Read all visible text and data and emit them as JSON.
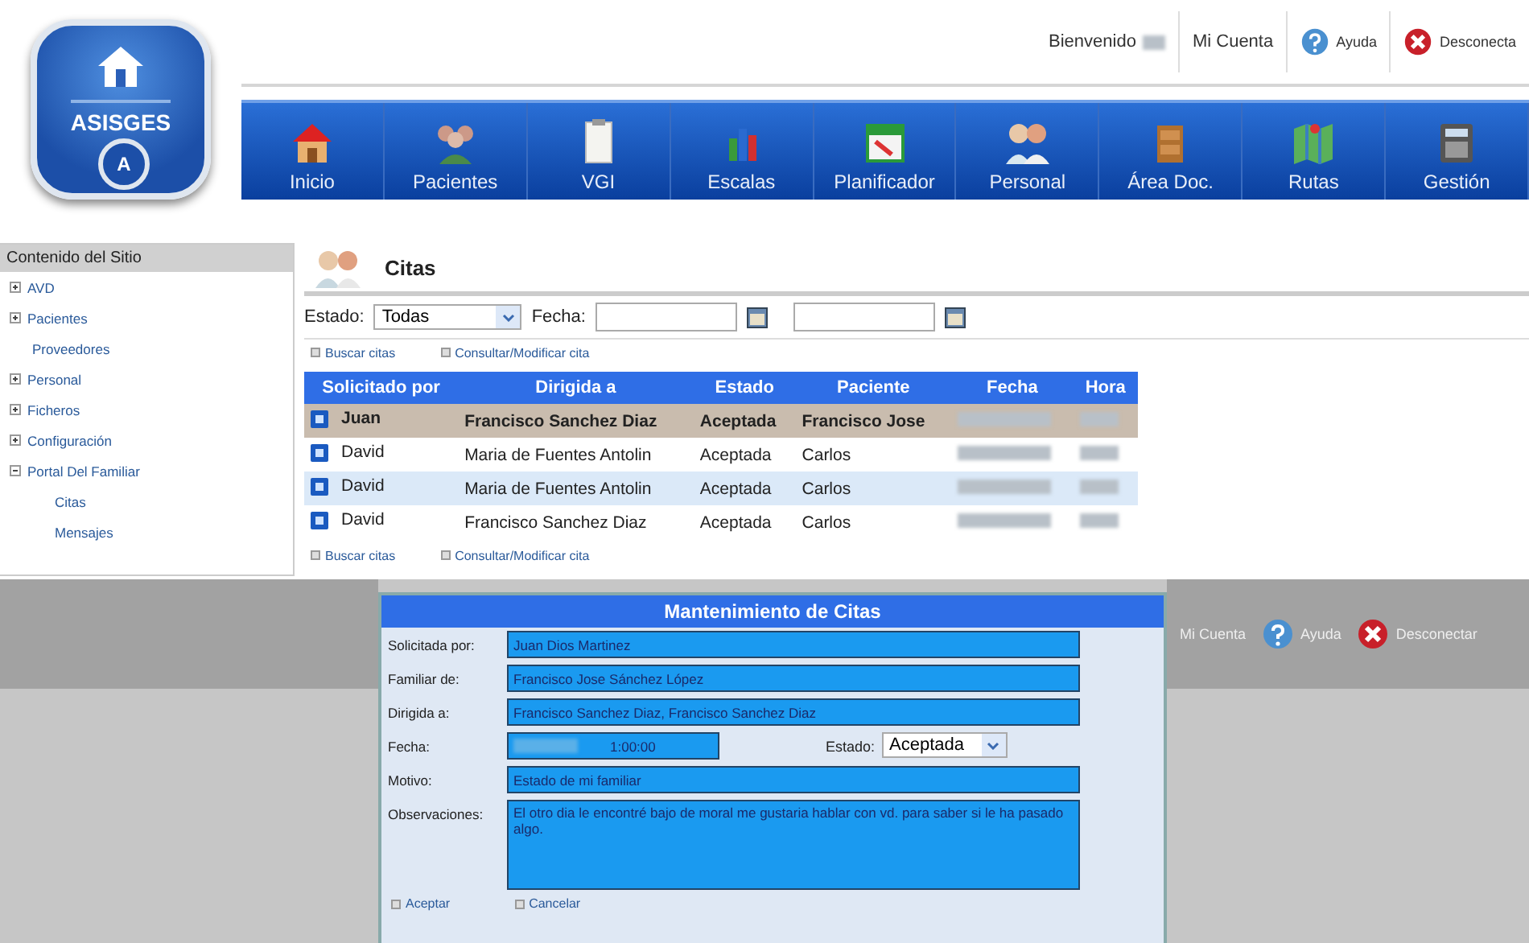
{
  "logo": {
    "name": "ASISGES",
    "badge": "A"
  },
  "user_bar": {
    "greeting": "Bienvenido",
    "links": [
      {
        "label": "Mi Cuenta",
        "kind": "plain"
      },
      {
        "label": "Ayuda",
        "kind": "help"
      },
      {
        "label": "Desconecta",
        "kind": "logout"
      }
    ]
  },
  "nav": [
    {
      "label": "Inicio",
      "kind": "home"
    },
    {
      "label": "Pacientes",
      "kind": "people"
    },
    {
      "label": "VGI",
      "kind": "clipboard"
    },
    {
      "label": "Escalas",
      "kind": "chart"
    },
    {
      "label": "Planificador",
      "kind": "calendar"
    },
    {
      "label": "Personal",
      "kind": "staff"
    },
    {
      "label": "Área Doc.",
      "kind": "cabinet"
    },
    {
      "label": "Rutas",
      "kind": "map"
    },
    {
      "label": "Gestión",
      "kind": "calculator"
    }
  ],
  "sidebar": {
    "title": "Contenido del Sitio",
    "items": [
      {
        "label": "AVD",
        "expanded": false
      },
      {
        "label": "Pacientes",
        "expanded": false
      },
      {
        "label": "Proveedores"
      },
      {
        "label": "Personal",
        "expanded": false
      },
      {
        "label": "Ficheros",
        "expanded": false
      },
      {
        "label": "Configuración",
        "expanded": false
      },
      {
        "label": "Portal Del Familiar",
        "expanded": true,
        "children": [
          {
            "label": "Citas"
          },
          {
            "label": "Mensajes"
          }
        ]
      }
    ]
  },
  "citas": {
    "title": "Citas",
    "estado_label": "Estado:",
    "estado_value": "Todas",
    "fecha_label": "Fecha:",
    "actions_top": [
      "Buscar citas",
      "Consultar/Modificar cita"
    ],
    "columns": [
      "Solicitado por",
      "Dirigida a",
      "Estado",
      "Paciente",
      "Fecha",
      "Hora"
    ],
    "rows": [
      {
        "solicitado_por": "Juan",
        "dirigida_a": "Francisco Sanchez Diaz",
        "estado": "Aceptada",
        "paciente": "Francisco Jose",
        "selected": true,
        "highlighted": false
      },
      {
        "solicitado_por": "David",
        "dirigida_a": "Maria de Fuentes Antolin",
        "estado": "Aceptada",
        "paciente": "Carlos",
        "selected": false,
        "highlighted": false
      },
      {
        "solicitado_por": "David",
        "dirigida_a": "Maria de Fuentes Antolin",
        "estado": "Aceptada",
        "paciente": "Carlos",
        "selected": false,
        "highlighted": true
      },
      {
        "solicitado_por": "David",
        "dirigida_a": "Francisco Sanchez Diaz",
        "estado": "Aceptada",
        "paciente": "Carlos",
        "selected": false,
        "highlighted": false
      }
    ],
    "actions_bottom": [
      "Buscar citas",
      "Consultar/Modificar cita"
    ]
  },
  "lower_bar": {
    "links": [
      {
        "label": "Mi Cuenta",
        "kind": "plain"
      },
      {
        "label": "Ayuda",
        "kind": "help"
      },
      {
        "label": "Desconectar",
        "kind": "logout"
      }
    ]
  },
  "dialog": {
    "title": "Mantenimiento de Citas",
    "fields": [
      {
        "label": "Solicitada por:",
        "value": "Juan Dios Martinez",
        "kind": "text"
      },
      {
        "label": "Familiar de:",
        "value": "Francisco Jose Sánchez López",
        "kind": "text"
      },
      {
        "label": "Dirigida a:",
        "value": "Francisco Sanchez Diaz, Francisco Sanchez Diaz",
        "kind": "text"
      },
      {
        "label": "Fecha:",
        "value": "1:00:00",
        "kind": "date",
        "estado_label": "Estado:",
        "estado_value": "Aceptada"
      },
      {
        "label": "Motivo:",
        "value": "Estado de mi familiar",
        "kind": "text"
      },
      {
        "label": "Observaciones:",
        "value": "El otro dia le encontré bajo de moral me gustaria hablar con vd. para saber si le ha pasado algo.",
        "kind": "textarea"
      }
    ],
    "buttons": [
      "Aceptar",
      "Cancelar"
    ]
  }
}
